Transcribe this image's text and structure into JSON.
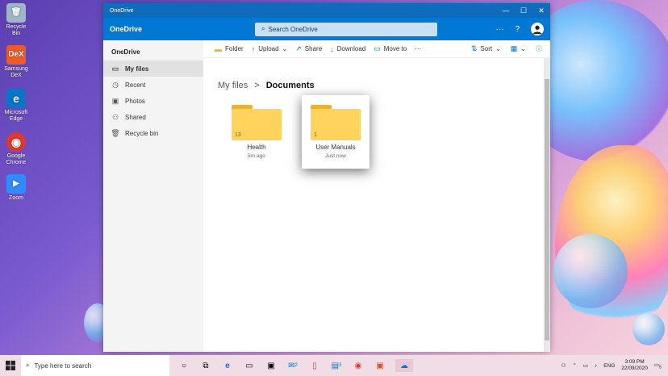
{
  "desktop": {
    "icons": [
      {
        "label": "Recycle Bin",
        "icon": "recycle-bin-icon",
        "color": "#9fb6c7"
      },
      {
        "label": "Samsung DeX",
        "icon": "dex-icon",
        "color": "#f05a28",
        "glyph": "DeX"
      },
      {
        "label": "Microsoft Edge",
        "icon": "edge-icon",
        "color": "#0a74c9",
        "glyph": "e"
      },
      {
        "label": "Google Chrome",
        "icon": "chrome-icon",
        "color": "#e0382e",
        "glyph": "◉"
      },
      {
        "label": "Zoom",
        "icon": "zoom-icon",
        "color": "#2d8cff",
        "glyph": "▶"
      }
    ]
  },
  "window": {
    "title": "OneDrive",
    "controls": {
      "minimize": "—",
      "maximize": "☐",
      "close": "✕"
    }
  },
  "appbar": {
    "brand": "OneDrive",
    "search_placeholder": "Search OneDrive",
    "more": "···",
    "help": "?"
  },
  "sidebar": {
    "home": "OneDrive",
    "items": [
      {
        "label": "My files",
        "icon": "folder-icon",
        "active": true
      },
      {
        "label": "Recent",
        "icon": "clock-icon",
        "active": false
      },
      {
        "label": "Photos",
        "icon": "image-icon",
        "active": false
      },
      {
        "label": "Shared",
        "icon": "people-icon",
        "active": false
      },
      {
        "label": "Recycle bin",
        "icon": "trash-icon",
        "active": false
      }
    ]
  },
  "commandbar": {
    "folder": "Folder",
    "upload": "Upload",
    "share": "Share",
    "download": "Download",
    "move_to": "Move to",
    "more": "···",
    "sort": "Sort"
  },
  "breadcrumb": {
    "root": "My files",
    "sep": ">",
    "current": "Documents"
  },
  "folders": [
    {
      "name": "Health",
      "count": "13",
      "time": "5m ago"
    },
    {
      "name": "User Manuals",
      "count": "1",
      "time": "Just now"
    }
  ],
  "taskbar": {
    "search_placeholder": "Type here to search",
    "lang": "ENG",
    "time": "3:09 PM",
    "date": "22/09/2020",
    "badges": {
      "mail": "2",
      "files": "3"
    },
    "notification_count": "5"
  }
}
